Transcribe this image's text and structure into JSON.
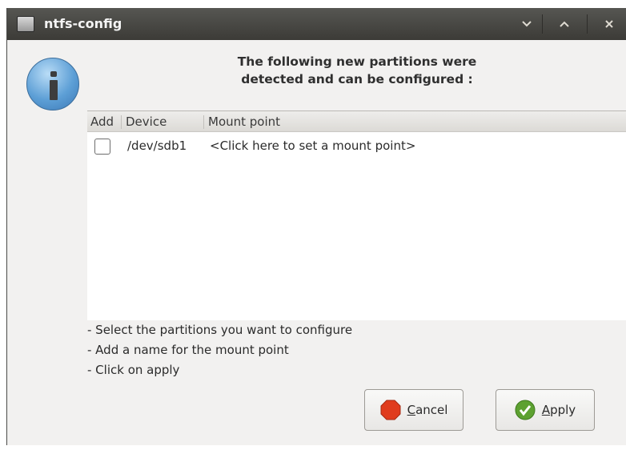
{
  "window": {
    "title": "ntfs-config",
    "controls": {
      "minimize_glyph": "⌄",
      "maximize_glyph": "^",
      "close_glyph": "×"
    }
  },
  "header": {
    "line1": "The following new partitions were",
    "line2": "detected and can be configured :"
  },
  "table": {
    "columns": {
      "add": "Add",
      "device": "Device",
      "mount_point": "Mount point"
    },
    "rows": [
      {
        "checked": false,
        "device": "/dev/sdb1",
        "mount_point": "<Click here to set a mount point>"
      }
    ]
  },
  "instructions": [
    "- Select the partitions you want to configure",
    "- Add a name for the mount point",
    "- Click on apply"
  ],
  "buttons": {
    "cancel": {
      "mnemonic": "C",
      "rest": "ancel",
      "icon": "stop-icon"
    },
    "apply": {
      "mnemonic": "A",
      "rest": "pply",
      "icon": "check-icon"
    }
  },
  "colors": {
    "titlebar": "#3c3b37",
    "info_icon": "#5d9fd6",
    "cancel_icon": "#e03c1d",
    "apply_icon": "#5da131"
  }
}
